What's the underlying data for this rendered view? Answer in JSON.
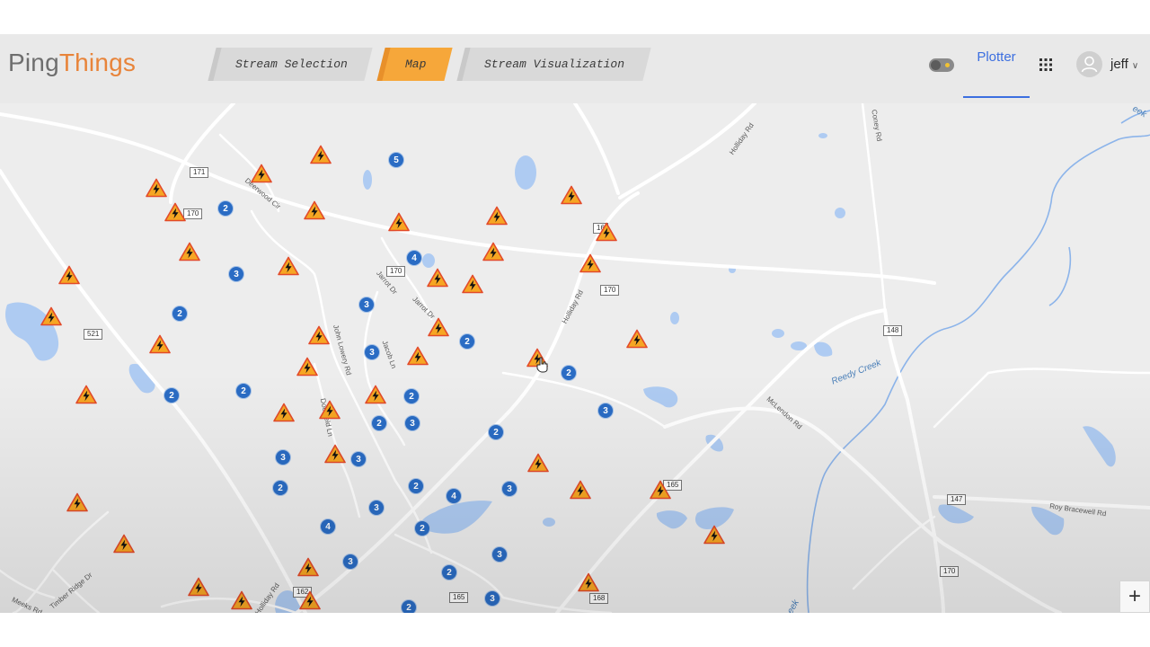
{
  "brand": {
    "part1": "Ping",
    "part2": "Things"
  },
  "nav": {
    "tabs": [
      {
        "label": "Stream Selection",
        "active": false
      },
      {
        "label": "Map",
        "active": true
      },
      {
        "label": "Stream Visualization",
        "active": false
      }
    ]
  },
  "header": {
    "plotter_label": "Plotter",
    "user_name": "jeff"
  },
  "map": {
    "zoom_in_label": "+",
    "route_shields": [
      "171",
      "170",
      "170",
      "170",
      "16",
      "521",
      "165",
      "147",
      "148",
      "170",
      "162",
      "165",
      "168"
    ],
    "road_names": [
      "Deerwood Cir",
      "Holliday Rd",
      "Jarrot Dr",
      "Jarrot Dr",
      "John Lowery Rd",
      "Jacob Ln",
      "Doerfield Ln",
      "McLendon Rd",
      "Roy Bracewell Rd",
      "Meeks Rd",
      "Timber Ridge Dr",
      "Holliday Rd",
      "Holliday Rd",
      "Coney Rd"
    ],
    "water_names": [
      "Reedy Creek",
      "eek",
      "eek"
    ],
    "cluster_counts": [
      "5",
      "2",
      "4",
      "3",
      "3",
      "2",
      "2",
      "3",
      "2",
      "2",
      "2",
      "2",
      "3",
      "2",
      "3",
      "2",
      "3",
      "3",
      "2",
      "4",
      "2",
      "3",
      "3",
      "2",
      "4",
      "3",
      "3",
      "2",
      "3",
      "2"
    ],
    "colors": {
      "warning_marker": "#f6a623",
      "cluster_marker": "#2a6cc4",
      "water": "#aecbf2",
      "accent": "#3c6fe0"
    }
  }
}
